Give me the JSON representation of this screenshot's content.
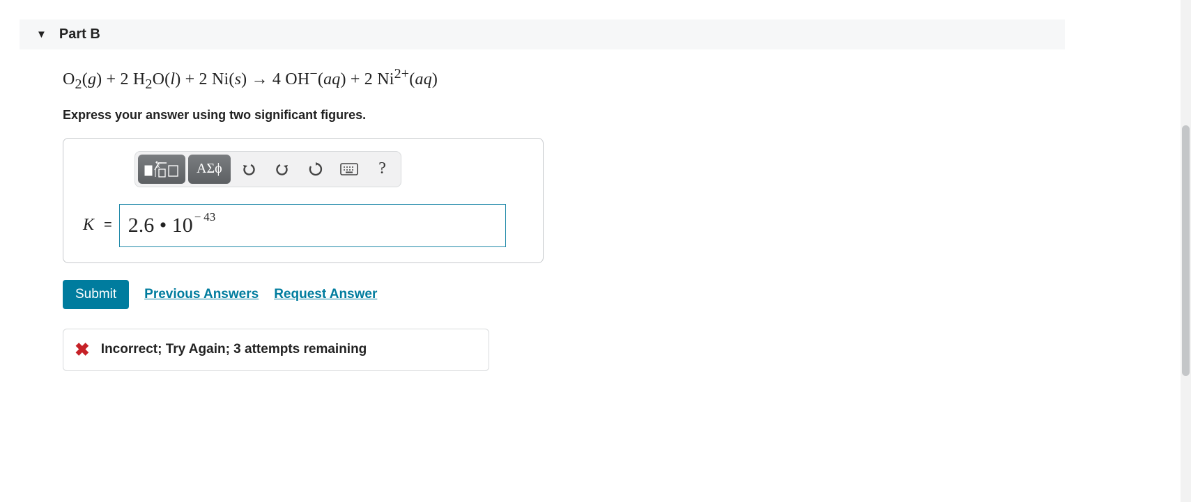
{
  "part": {
    "label": "Part B"
  },
  "question": {
    "instruction": "Express your answer using two significant figures."
  },
  "toolbar": {
    "greek_label": "ΑΣϕ",
    "help_label": "?"
  },
  "answer": {
    "var": "K",
    "eq": "=",
    "display_base": "2.6 • 10",
    "display_exp_sign": "−",
    "display_exp_num": "43"
  },
  "actions": {
    "submit": "Submit",
    "previous": "Previous Answers",
    "request": "Request Answer"
  },
  "feedback": {
    "message": "Incorrect; Try Again; 3 attempts remaining"
  }
}
